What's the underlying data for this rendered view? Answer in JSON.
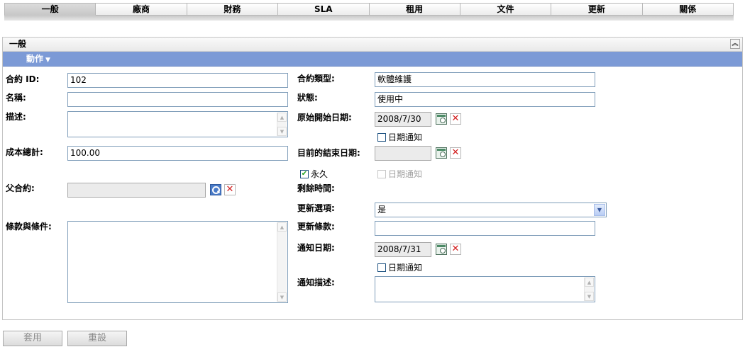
{
  "tabs": [
    {
      "label": "一般",
      "active": true
    },
    {
      "label": "廠商"
    },
    {
      "label": "財務"
    },
    {
      "label": "SLA"
    },
    {
      "label": "租用"
    },
    {
      "label": "文件"
    },
    {
      "label": "更新"
    },
    {
      "label": "關係"
    }
  ],
  "panel": {
    "title": "一般",
    "collapse_icon": "double-chevron-up-icon",
    "action_menu": "動作"
  },
  "form": {
    "contract_id": {
      "label": "合約 ID:",
      "value": "102"
    },
    "name": {
      "label": "名稱:",
      "value": ""
    },
    "description": {
      "label": "描述:",
      "value": ""
    },
    "total_cost": {
      "label": "成本總計:",
      "value": "100.00"
    },
    "parent_contract": {
      "label": "父合約:",
      "value": ""
    },
    "terms": {
      "label": "條款與條件:",
      "value": ""
    },
    "contract_type": {
      "label": "合約類型:",
      "value": "軟體維護"
    },
    "status": {
      "label": "狀態:",
      "value": "使用中"
    },
    "original_start_date": {
      "label": "原始開始日期:",
      "value": "2008/7/30",
      "notify_label": "日期通知",
      "notify_checked": false
    },
    "current_end_date": {
      "label": "目前的結束日期:",
      "value": "",
      "notify_label": "日期通知",
      "notify_checked": false
    },
    "perpetual": {
      "label": "永久",
      "checked": true
    },
    "time_remaining": {
      "label": "剩餘時間:",
      "value": ""
    },
    "renewal_option": {
      "label": "更新選項:",
      "value": "是"
    },
    "renewal_terms": {
      "label": "更新條款:",
      "value": ""
    },
    "notify_date": {
      "label": "通知日期:",
      "value": "2008/7/31",
      "notify_label": "日期通知",
      "notify_checked": false
    },
    "notify_description": {
      "label": "通知描述:",
      "value": ""
    }
  },
  "buttons": {
    "apply": "套用",
    "reset": "重設"
  }
}
